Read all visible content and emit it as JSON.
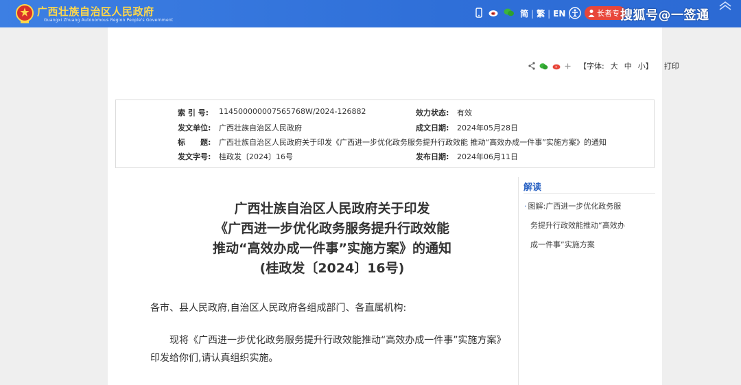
{
  "header": {
    "site_title": "广西壮族自治区人民政府",
    "site_subtitle": "Guangxi Zhuang Autonomous Region People's Government",
    "lang_simplified": "简",
    "lang_traditional": "繁",
    "lang_english": "EN",
    "sep": "|",
    "elder_mode": "长者专",
    "watermark": "搜狐号@一签通"
  },
  "toolbar": {
    "font_size_label": "【字体:",
    "font_large": "大",
    "font_medium": "中",
    "font_small": "小】",
    "print": "打印"
  },
  "meta": {
    "index_label": "索 引 号:",
    "index_value": "114500000007565768W/2024-126882",
    "validity_label": "效力状态:",
    "validity_value": "有效",
    "issuer_label": "发文单位:",
    "issuer_value": "广西壮族自治区人民政府",
    "created_label": "成文日期:",
    "created_value": "2024年05月28日",
    "title_label": "标　　题:",
    "title_value": "广西壮族自治区人民政府关于印发《广西进一步优化政务服务提升行政效能 推动“高效办成一件事”实施方案》的通知",
    "docno_label": "发文字号:",
    "docno_value": "桂政发〔2024〕16号",
    "published_label": "发布日期:",
    "published_value": "2024年06月11日"
  },
  "side": {
    "title": "解读",
    "bullet": "·",
    "item_line1": "图解:广西进一步优化政务服",
    "item_line2": "务提升行政效能推动“高效办",
    "item_line3": "成一件事”实施方案"
  },
  "document": {
    "title_line1": "广西壮族自治区人民政府关于印发",
    "title_line2": "《广西进一步优化政务服务提升行政效能",
    "title_line3": "推动“高效办成一件事”实施方案》的通知",
    "title_line4": "(桂政发〔2024〕16号)",
    "addressee": "各市、县人民政府,自治区人民政府各组成部门、各直属机构:",
    "paragraph1": "现将《广西进一步优化政务服务提升行政效能推动“高效办成一件事”实施方案》印发给你们,请认真组织实施。"
  },
  "colors": {
    "topbar": "#2f6fd8",
    "title_gold": "#ffd84a",
    "accent_blue": "#2a63c4",
    "elder_red": "#e8463a"
  }
}
